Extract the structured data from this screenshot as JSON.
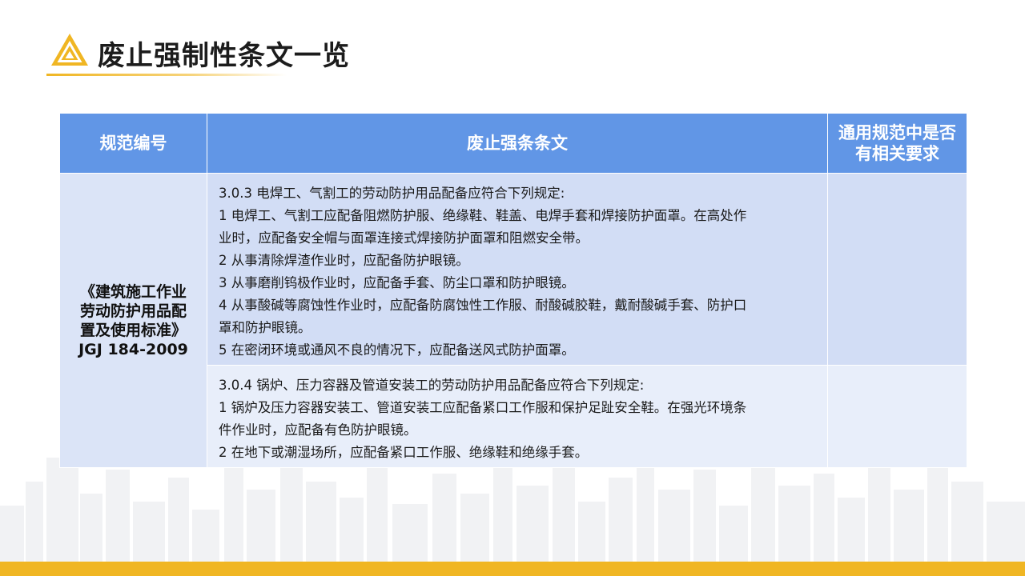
{
  "title": "废止强制性条文一览",
  "table": {
    "headers": [
      "规范编号",
      "废止强条条文",
      "通用规范中是否有相关要求"
    ],
    "standard": {
      "lines": [
        "《建筑施工作业",
        "劳动防护用品配",
        "置及使用标准》",
        "JGJ 184-2009"
      ]
    },
    "rows": [
      {
        "clause_lines": [
          "3.0.3 电焊工、气割工的劳动防护用品配备应符合下列规定:",
          "1 电焊工、气割工应配备阻燃防护服、绝缘鞋、鞋盖、电焊手套和焊接防护面罩。在高处作",
          "业时，应配备安全帽与面罩连接式焊接防护面罩和阻燃安全带。",
          "2 从事清除焊渣作业时，应配备防护眼镜。",
          "3 从事磨削钨极作业时，应配备手套、防尘口罩和防护眼镜。",
          "4 从事酸碱等腐蚀性作业时，应配备防腐蚀性工作服、耐酸碱胶鞋，戴耐酸碱手套、防护口",
          "罩和防护眼镜。",
          "5 在密闭环境或通风不良的情况下，应配备送风式防护面罩。"
        ],
        "related": ""
      },
      {
        "clause_lines": [
          "3.0.4 锅炉、压力容器及管道安装工的劳动防护用品配备应符合下列规定:",
          "1 锅炉及压力容器安装工、管道安装工应配备紧口工作服和保护足趾安全鞋。在强光环境条",
          "件作业时，应配备有色防护眼镜。",
          "2 在地下或潮湿场所，应配备紧口工作服、绝缘鞋和绝缘手套。"
        ],
        "related": ""
      }
    ]
  },
  "colors": {
    "accent": "#f0b623",
    "header_bg": "#6196e6",
    "row_a_bg": "#d2ddf5",
    "row_b_bg": "#e8eefa",
    "code_cell_bg": "#dbe4f7"
  },
  "icons": {
    "logo": "triangle-logo-icon",
    "background": "city-skyline"
  }
}
